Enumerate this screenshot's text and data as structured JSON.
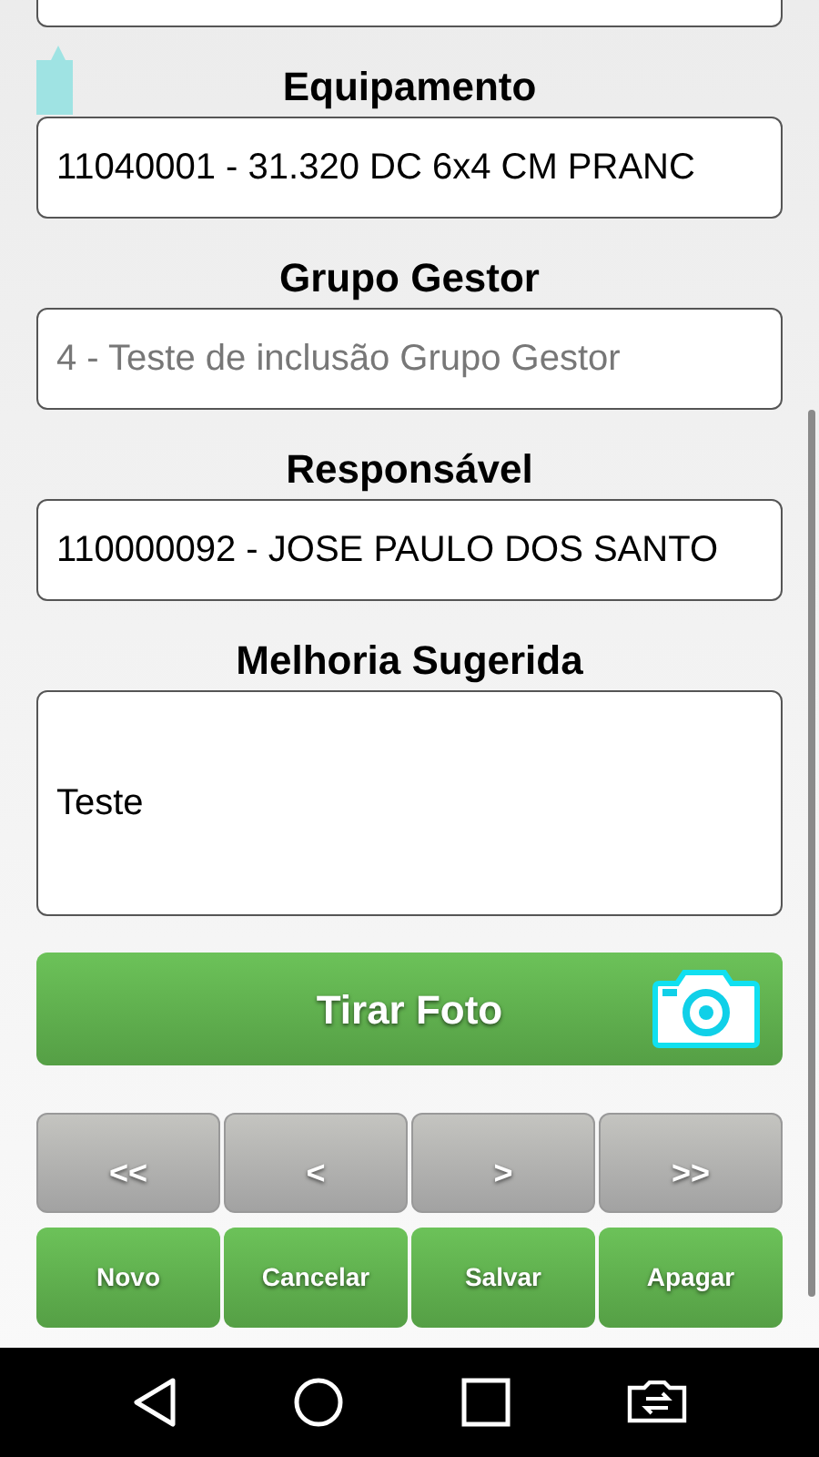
{
  "fields": [
    {
      "label": "Equipamento",
      "kind": "input",
      "value": "11040001 - 31.320 DC 6x4 CM PRANC"
    },
    {
      "label": "Grupo Gestor",
      "kind": "input",
      "placeholder": "4 - Teste de inclusão Grupo Gestor"
    },
    {
      "label": "Responsável",
      "kind": "input",
      "value": "110000092 - JOSE PAULO DOS SANTO"
    },
    {
      "label": "Melhoria Sugerida",
      "kind": "textarea",
      "value": "Teste"
    }
  ],
  "photo_button": {
    "label": "Tirar Foto"
  },
  "nav_buttons": [
    "<<",
    "<",
    ">",
    ">>"
  ],
  "action_buttons": [
    "Novo",
    "Cancelar",
    "Salvar",
    "Apagar"
  ]
}
